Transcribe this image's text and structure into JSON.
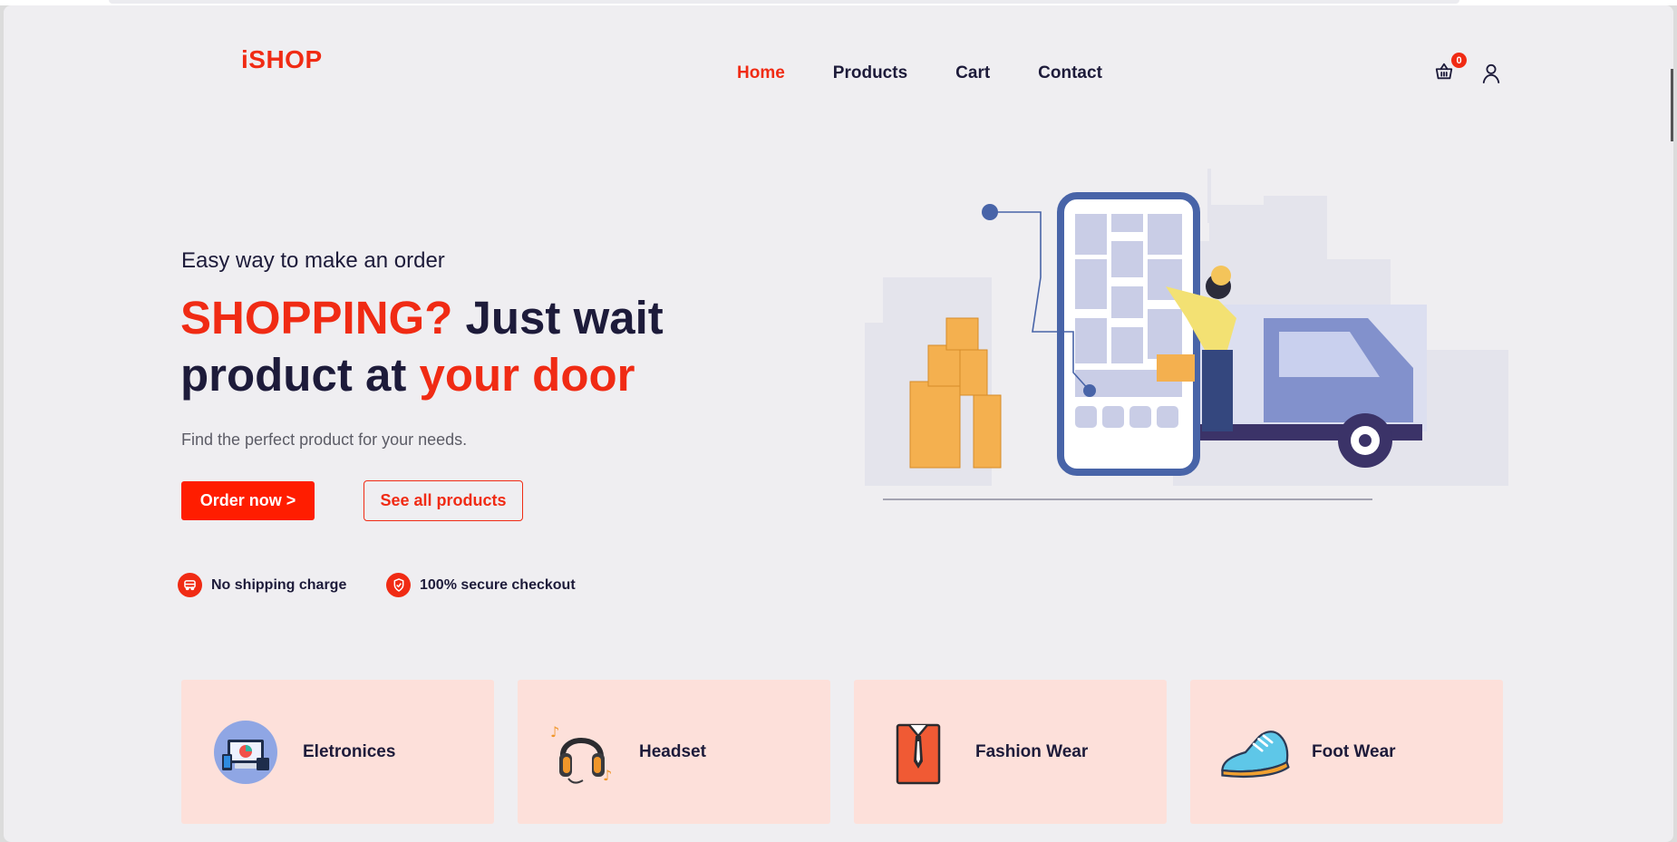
{
  "brand": {
    "logo": "iSHOP"
  },
  "nav": {
    "items": [
      {
        "label": "Home",
        "active": true
      },
      {
        "label": "Products",
        "active": false
      },
      {
        "label": "Cart",
        "active": false
      },
      {
        "label": "Contact",
        "active": false
      }
    ]
  },
  "header_icons": {
    "cart_icon": "shopping-basket-icon",
    "cart_count": "0",
    "user_icon": "user-icon"
  },
  "hero": {
    "tagline": "Easy way to make an order",
    "headline_part1": "SHOPPING?",
    "headline_part2": " Just wait product at ",
    "headline_part3": "your door",
    "description": "Find the perfect product for your needs.",
    "order_button": "Order now >",
    "products_button": "See all products"
  },
  "features": [
    {
      "icon": "truck-icon",
      "label": "No shipping charge"
    },
    {
      "icon": "shield-check-icon",
      "label": "100% secure checkout"
    }
  ],
  "categories": [
    {
      "icon": "electronics-devices-icon",
      "label": "Eletronices"
    },
    {
      "icon": "headset-icon",
      "label": "Headset"
    },
    {
      "icon": "shirt-tie-icon",
      "label": "Fashion Wear"
    },
    {
      "icon": "sneaker-icon",
      "label": "Foot Wear"
    }
  ],
  "colors": {
    "accent": "#f02b14",
    "text": "#1d1b3a",
    "card": "#fde0da",
    "background": "#efeef1"
  }
}
